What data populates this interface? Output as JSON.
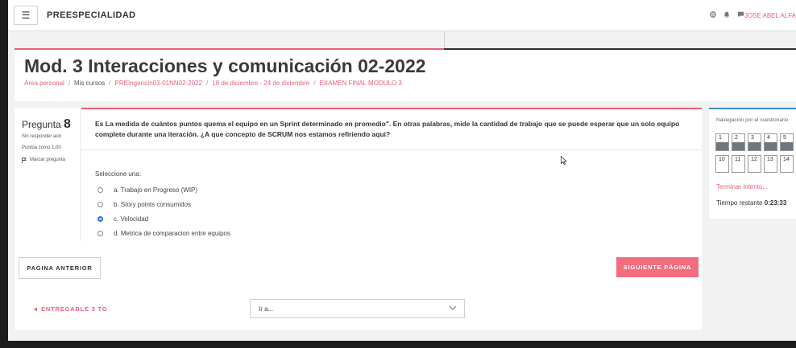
{
  "navbar": {
    "menu_icon": "hamburger-icon",
    "brand": "PREESPECIALIDAD",
    "icons": [
      "globe-icon",
      "bell-icon",
      "chat-icon"
    ],
    "user_name": "JOSE ABEL ALFA"
  },
  "header": {
    "title": "Mod. 3 Interacciones y comunicación 02-2022",
    "breadcrumb": [
      {
        "label": "Área personal",
        "link": true
      },
      {
        "label": "Mis cursos",
        "link": false
      },
      {
        "label": "PREIngensIn03-01NN02-2022",
        "link": true
      },
      {
        "label": "18 de diciembre - 24 de diciembre",
        "link": true
      },
      {
        "label": "EXAMEN FINAL MODULO 3",
        "link": true
      }
    ],
    "separator": "/"
  },
  "question_info": {
    "label": "Pregunta",
    "number": "8",
    "status": "Sin responder aún",
    "points": "Puntúa como 1,00",
    "flag_label": "Marcar pregunta",
    "flag_icon": "flag-icon"
  },
  "question": {
    "text": "Es La medida de cuántos puntos quema el equipo en un Sprint determinado en promedio\". En otras palabras, mide la cantidad de trabajo que se puede esperar que un solo equipo complete durante una iteración. ¿A que concepto de SCRUM nos estamos refiriendo aqui?",
    "prompt": "Seleccione una:",
    "answers": [
      {
        "label": "a. Trabajo en Progreso (WIP)",
        "selected": false
      },
      {
        "label": "b. Story points consumidos",
        "selected": false
      },
      {
        "label": "c. Velocidad",
        "selected": true
      },
      {
        "label": "d. Metrica de comparacion entre equipos",
        "selected": false
      }
    ]
  },
  "quiz_nav": {
    "title": "Navegación por el cuestionario",
    "row1": [
      "1",
      "2",
      "3",
      "4",
      "5"
    ],
    "row2": [
      "10",
      "11",
      "12",
      "13",
      "14"
    ],
    "finish_link": "Terminar intento...",
    "time_label": "Tiempo restante",
    "time_value": "0:23:33"
  },
  "buttons": {
    "prev": "PAGINA ANTERIOR",
    "next": "SIGUIENTE PÁGINA"
  },
  "footer_nav": {
    "prev_activity": "◄ ENTREGABLE 3 TG",
    "jump_label": "Ir a...",
    "chevron_icon": "chevron-down-icon"
  },
  "colors": {
    "accent": "#e8607a",
    "next_button": "#f26d7d",
    "nav_border": "#3a8fc5",
    "radio_selected": "#2a6fe0"
  }
}
